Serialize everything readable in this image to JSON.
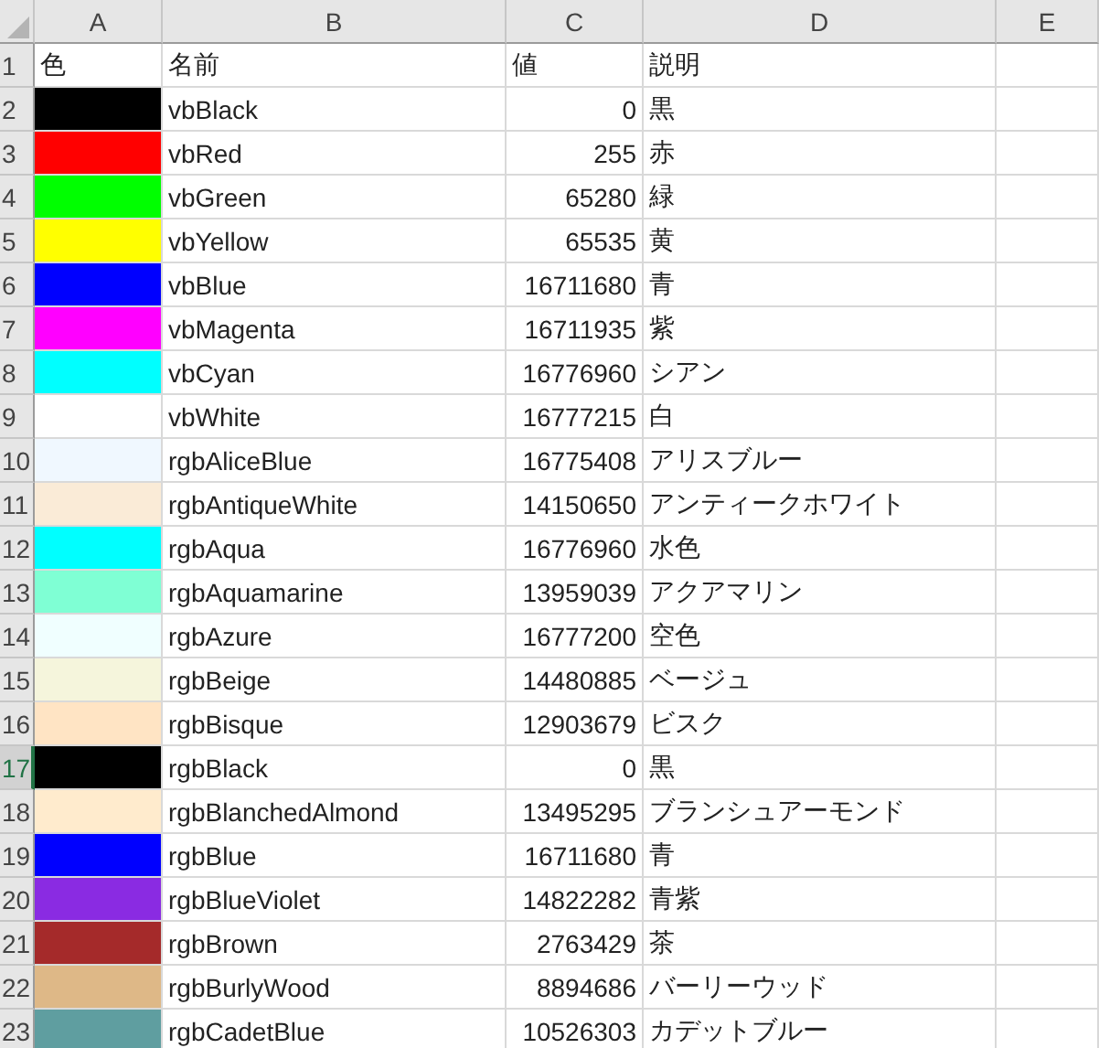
{
  "columns": [
    "A",
    "B",
    "C",
    "D",
    "E"
  ],
  "rows": [
    {
      "number": "1",
      "selected": false,
      "kind": "text",
      "a": "色",
      "b": "名前",
      "c": "値",
      "d": "説明"
    },
    {
      "number": "2",
      "selected": false,
      "kind": "swatch",
      "color": "#000000",
      "b": "vbBlack",
      "c": "0",
      "d": "黒"
    },
    {
      "number": "3",
      "selected": false,
      "kind": "swatch",
      "color": "#ff0000",
      "b": "vbRed",
      "c": "255",
      "d": "赤"
    },
    {
      "number": "4",
      "selected": false,
      "kind": "swatch",
      "color": "#00ff00",
      "b": "vbGreen",
      "c": "65280",
      "d": "緑"
    },
    {
      "number": "5",
      "selected": false,
      "kind": "swatch",
      "color": "#ffff00",
      "b": "vbYellow",
      "c": "65535",
      "d": "黄"
    },
    {
      "number": "6",
      "selected": false,
      "kind": "swatch",
      "color": "#0000ff",
      "b": "vbBlue",
      "c": "16711680",
      "d": "青"
    },
    {
      "number": "7",
      "selected": false,
      "kind": "swatch",
      "color": "#ff00ff",
      "b": "vbMagenta",
      "c": "16711935",
      "d": "紫"
    },
    {
      "number": "8",
      "selected": false,
      "kind": "swatch",
      "color": "#00ffff",
      "b": "vbCyan",
      "c": "16776960",
      "d": "シアン"
    },
    {
      "number": "9",
      "selected": false,
      "kind": "swatch",
      "color": "#ffffff",
      "b": "vbWhite",
      "c": "16777215",
      "d": "白"
    },
    {
      "number": "10",
      "selected": false,
      "kind": "swatch",
      "color": "#f0f8ff",
      "b": "rgbAliceBlue",
      "c": "16775408",
      "d": "アリスブルー"
    },
    {
      "number": "11",
      "selected": false,
      "kind": "swatch",
      "color": "#faebd7",
      "b": "rgbAntiqueWhite",
      "c": "14150650",
      "d": "アンティークホワイト"
    },
    {
      "number": "12",
      "selected": false,
      "kind": "swatch",
      "color": "#00ffff",
      "b": "rgbAqua",
      "c": "16776960",
      "d": "水色"
    },
    {
      "number": "13",
      "selected": false,
      "kind": "swatch",
      "color": "#7fffd4",
      "b": "rgbAquamarine",
      "c": "13959039",
      "d": "アクアマリン"
    },
    {
      "number": "14",
      "selected": false,
      "kind": "swatch",
      "color": "#f0ffff",
      "b": "rgbAzure",
      "c": "16777200",
      "d": "空色"
    },
    {
      "number": "15",
      "selected": false,
      "kind": "swatch",
      "color": "#f5f5dc",
      "b": "rgbBeige",
      "c": "14480885",
      "d": "ベージュ"
    },
    {
      "number": "16",
      "selected": false,
      "kind": "swatch",
      "color": "#ffe4c4",
      "b": "rgbBisque",
      "c": "12903679",
      "d": "ビスク"
    },
    {
      "number": "17",
      "selected": true,
      "kind": "swatch",
      "color": "#000000",
      "b": "rgbBlack",
      "c": "0",
      "d": "黒"
    },
    {
      "number": "18",
      "selected": false,
      "kind": "swatch",
      "color": "#ffebcd",
      "b": "rgbBlanchedAlmond",
      "c": "13495295",
      "d": "ブランシュアーモンド"
    },
    {
      "number": "19",
      "selected": false,
      "kind": "swatch",
      "color": "#0000ff",
      "b": "rgbBlue",
      "c": "16711680",
      "d": "青"
    },
    {
      "number": "20",
      "selected": false,
      "kind": "swatch",
      "color": "#8a2be2",
      "b": "rgbBlueViolet",
      "c": "14822282",
      "d": "青紫"
    },
    {
      "number": "21",
      "selected": false,
      "kind": "swatch",
      "color": "#a52a2a",
      "b": "rgbBrown",
      "c": "2763429",
      "d": "茶"
    },
    {
      "number": "22",
      "selected": false,
      "kind": "swatch",
      "color": "#deb887",
      "b": "rgbBurlyWood",
      "c": "8894686",
      "d": "バーリーウッド"
    },
    {
      "number": "23",
      "selected": false,
      "kind": "swatch",
      "color": "#5f9ea0",
      "b": "rgbCadetBlue",
      "c": "10526303",
      "d": "カデットブルー"
    }
  ]
}
